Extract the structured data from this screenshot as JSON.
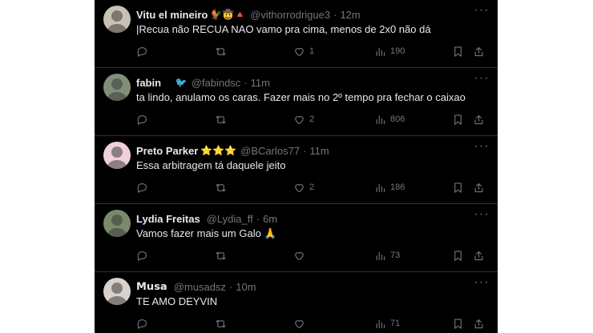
{
  "colors": {
    "background": "#000000",
    "text": "#e7e9ea",
    "muted": "#71767b",
    "divider": "#2f3336"
  },
  "tweets": [
    {
      "name": "Vitu el mineiro",
      "badges": "🐓🤠🔺",
      "handle": "@vithorrodrigue3",
      "dot": "·",
      "time": "12m",
      "text": "|Recua não RECUA NAO vamo pra cima, menos de 2x0 não dá",
      "replies": "",
      "retweets": "",
      "likes": "1",
      "views": "190",
      "avatar_bg": "#c9c2b4"
    },
    {
      "name": "fabin",
      "badges": "▭ 🐦",
      "handle": "@fabindsc",
      "dot": "·",
      "time": "11m",
      "text": "ta lindo, anulamo os caras. Fazer mais no 2º tempo pra fechar o caixao",
      "replies": "",
      "retweets": "",
      "likes": "2",
      "views": "806",
      "avatar_bg": "#7f8f78"
    },
    {
      "name": "Preto Parker",
      "badges": "⭐⭐⭐",
      "handle": "@BCarlos77",
      "dot": "·",
      "time": "11m",
      "text": "Essa arbitragem tá daquele jeito",
      "replies": "",
      "retweets": "",
      "likes": "2",
      "views": "186",
      "avatar_bg": "#f0d0dc"
    },
    {
      "name": "Lydia Freitas",
      "badges": "",
      "handle": "@Lydia_ff",
      "dot": "·",
      "time": "6m",
      "text": "Vamos fazer mais um Galo 🙏",
      "replies": "",
      "retweets": "",
      "likes": "",
      "views": "73",
      "avatar_bg": "#7a8a6a"
    },
    {
      "name": "𝗠𝘂𝘀𝗮",
      "badges": "",
      "handle": "@musadsz",
      "dot": "·",
      "time": "10m",
      "text": "TE AMO DEYVIN",
      "replies": "",
      "retweets": "",
      "likes": "",
      "views": "71",
      "avatar_bg": "#d8d2cc"
    }
  ],
  "icons": {
    "more": "more-icon",
    "reply": "reply-icon",
    "retweet": "retweet-icon",
    "like": "heart-icon",
    "views": "views-icon",
    "bookmark": "bookmark-icon",
    "share": "share-icon"
  }
}
